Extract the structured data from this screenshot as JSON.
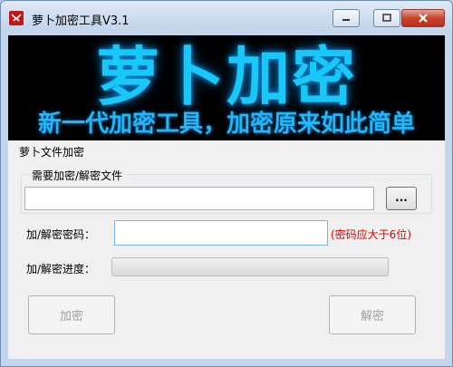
{
  "window": {
    "title": "萝卜加密工具V3.1",
    "controls": {
      "minimize": "minimize-icon",
      "maximize": "maximize-icon",
      "close": "close-icon"
    }
  },
  "banner": {
    "main": "萝卜加密",
    "sub": "新一代加密工具，加密原来如此简单"
  },
  "section": {
    "title": "萝卜文件加密",
    "file_group_label": "需要加密/解密文件",
    "file_value": "",
    "browse_label": "...",
    "password_label": "加/解密密码：",
    "password_value": "",
    "password_hint": "(密码应大于6位)",
    "progress_label": "加/解密进度：",
    "progress": 0
  },
  "buttons": {
    "encrypt": "加密",
    "decrypt": "解密"
  },
  "colors": {
    "banner_bg": "#000000",
    "banner_text": "#18c8f8",
    "hint": "#e00000"
  }
}
